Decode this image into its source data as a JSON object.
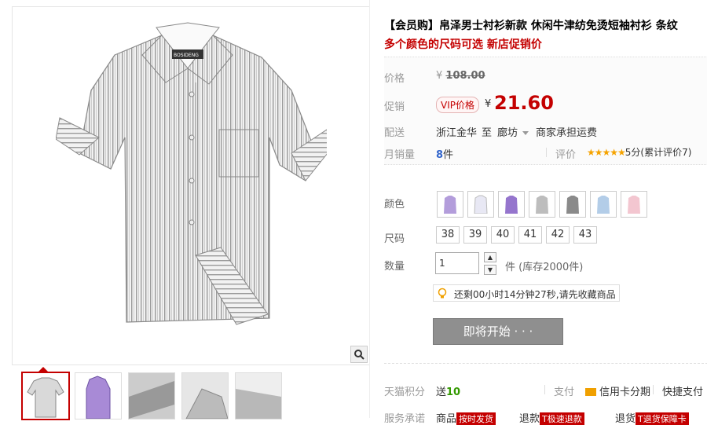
{
  "product": {
    "title": "【会员购】帛泽男士衬衫新款 休闲牛津纺免烫短袖衬衫 条纹",
    "subtitle": "多个颜色的尺码可选 新店促销价"
  },
  "price": {
    "label": "价格",
    "currency": "¥",
    "original": "108.00",
    "promo_label": "促销",
    "vip_tag": "VIP价格",
    "current": "21.60",
    "accent_color": "#c40000"
  },
  "shipping": {
    "label": "配送",
    "from": "浙江金华",
    "to_word": "至",
    "to": "廊坊",
    "fee": "商家承担运费"
  },
  "sales": {
    "label": "月销量",
    "count": "8",
    "unit": "件",
    "review_label": "评价",
    "stars": "★★★★★",
    "score_text": "5分(累计评价7)"
  },
  "options": {
    "color_label": "颜色",
    "color_swatches": [
      "purple-shirt",
      "white-shirt",
      "violet-shirt",
      "gray-shirt",
      "dark-gray-shirt",
      "blue-shirt",
      "pink-shirt"
    ],
    "size_label": "尺码",
    "sizes": [
      "38",
      "39",
      "40",
      "41",
      "42",
      "43"
    ],
    "qty_label": "数量",
    "qty_value": "1",
    "stock_text": "件 (库存2000件)"
  },
  "notice": {
    "icon": "lightbulb-icon",
    "text": "还剩00小时14分钟27秒,请先收藏商品"
  },
  "buy_button": {
    "label": "即将开始 · · ·"
  },
  "bottom": {
    "points_label": "天猫积分",
    "points_prefix": "送",
    "points_value": "10",
    "pay_label": "支付",
    "pay_card": "信用卡分期",
    "pay_quick": "快捷支付",
    "promise_label": "服务承诺",
    "promise_1_prefix": "商品",
    "promise_1_badge": "按时发货",
    "promise_2_prefix": "退款",
    "promise_2_badge": "T极速退款",
    "promise_3_prefix": "退货",
    "promise_3_badge": "T退货保障卡"
  }
}
